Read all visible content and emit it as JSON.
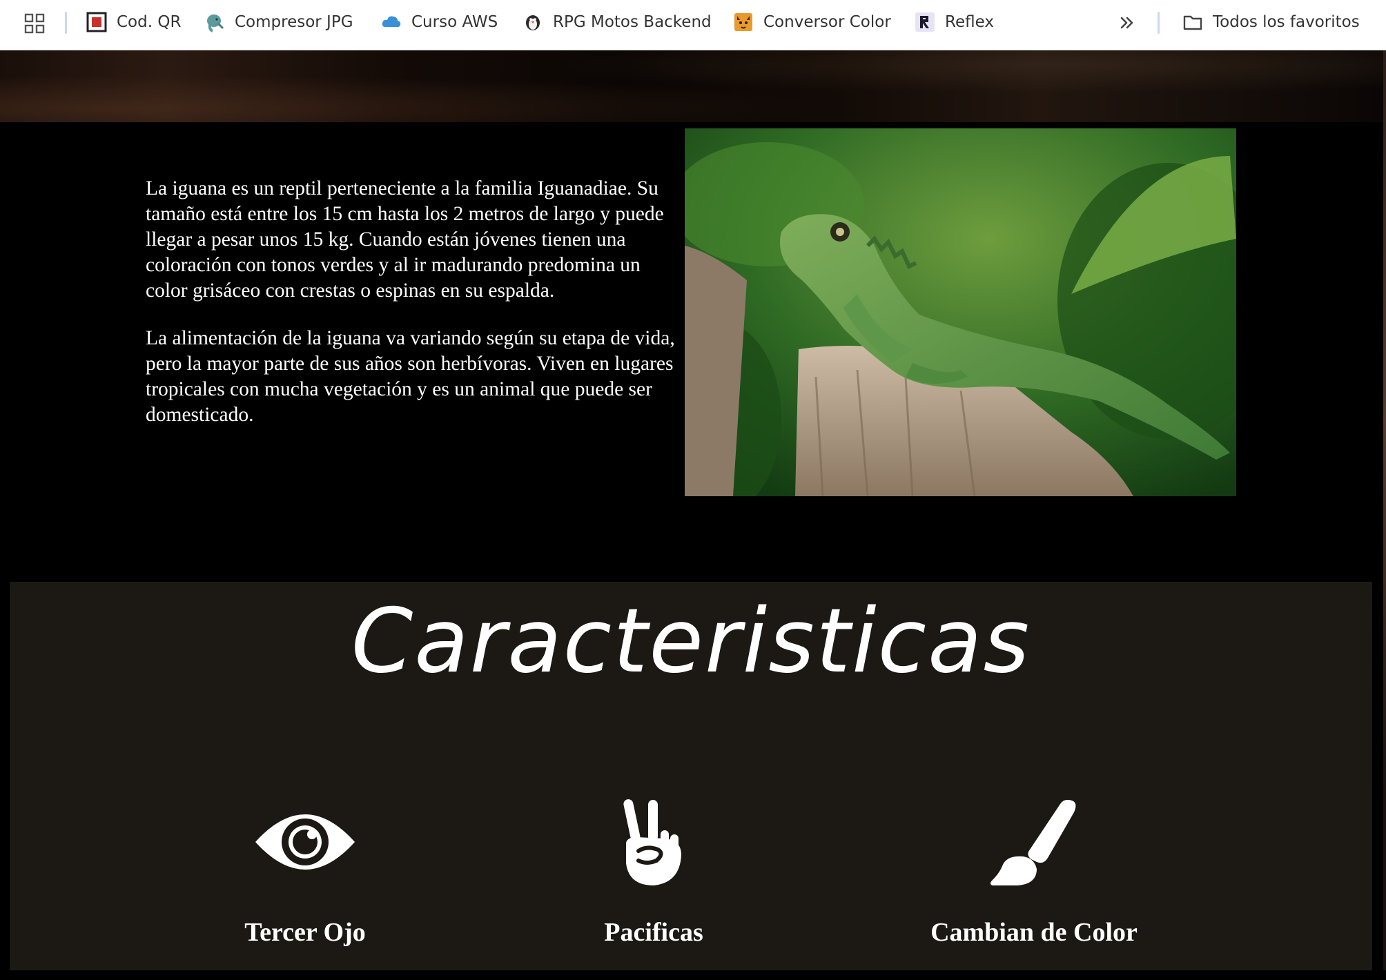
{
  "bookmarks_bar": {
    "apps_icon": "apps-grid-icon",
    "items": [
      {
        "label": "Cod. QR",
        "icon": "qr-code-icon"
      },
      {
        "label": "Compresor JPG",
        "icon": "elephant-icon"
      },
      {
        "label": "Curso AWS",
        "icon": "cloud-icon"
      },
      {
        "label": "RPG Motos Backend",
        "icon": "penguin-icon"
      },
      {
        "label": "Conversor Color",
        "icon": "cat-face-icon"
      },
      {
        "label": "Reflex",
        "icon": "reflex-logo-icon"
      }
    ],
    "more_icon": "chevron-double-right-icon",
    "all_bookmarks": {
      "label": "Todos los favoritos",
      "icon": "folder-icon"
    }
  },
  "intro": {
    "paragraphs": [
      "La iguana es un reptil perteneciente a la familia Iguanadiae. Su tamaño está entre los 15 cm hasta los 2 metros de largo y puede llegar a pesar unos 15 kg. Cuando están jóvenes tienen una coloración con tonos verdes y al ir madurando predomina un color grisáceo con crestas o espinas en su espalda.",
      "La alimentación de la iguana va variando según su etapa de vida, pero la mayor parte de sus años son herbívoras. Viven en lugares tropicales con mucha vegetación y es un animal que puede ser domesticado."
    ]
  },
  "features": {
    "title": "Caracteristicas",
    "items": [
      {
        "label": "Tercer Ojo",
        "icon": "eye-icon"
      },
      {
        "label": "Pacificas",
        "icon": "peace-hand-icon"
      },
      {
        "label": "Cambian de Color",
        "icon": "paintbrush-icon"
      }
    ]
  },
  "colors": {
    "page_background": "#000000",
    "features_background": "#1c1914",
    "bookmarks_background": "#ffffff",
    "text_light": "#ffffff"
  }
}
